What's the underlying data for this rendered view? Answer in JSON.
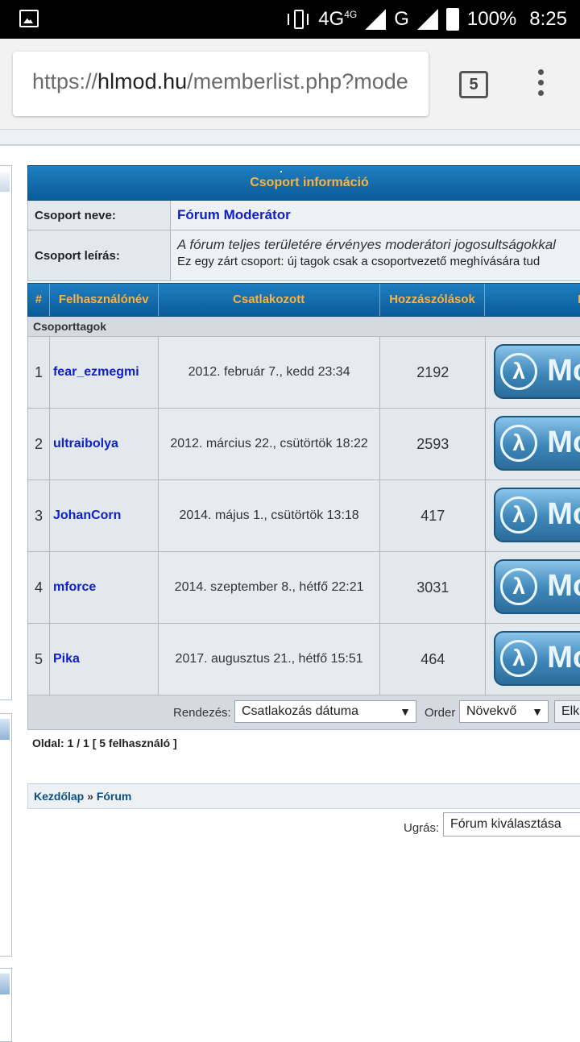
{
  "status_bar": {
    "network": "4G",
    "network_sup": "4G",
    "network2": "G",
    "battery": "100%",
    "time": "8:25"
  },
  "browser": {
    "url_prefix": "https://",
    "url_host": "hlmod.hu",
    "url_path": "/memberlist.php?mode",
    "tab_count": "5"
  },
  "group": {
    "header": "Csoport információ",
    "name_label": "Csoport neve:",
    "name_value": "Fórum Moderátor",
    "desc_label": "Csoport leírás:",
    "desc_line1": "A fórum teljes területére érvényes moderátori jogosultságokkal",
    "desc_line2": "Ez egy zárt csoport: új tagok csak a csoportvezető meghívására tud"
  },
  "columns": {
    "num": "#",
    "user": "Felhasználónév",
    "joined": "Csatlakozott",
    "posts": "Hozzászólások",
    "rank": "R"
  },
  "section_label": "Csoporttagok",
  "members": [
    {
      "num": "1",
      "name": "fear_ezmegmi",
      "joined": "2012. február 7., kedd 23:34",
      "posts": "2192",
      "rank_text": "Mo"
    },
    {
      "num": "2",
      "name": "ultraibolya",
      "joined": "2012. március 22., csütörtök 18:22",
      "posts": "2593",
      "rank_text": "Mo"
    },
    {
      "num": "3",
      "name": "JohanCorn",
      "joined": "2014. május 1., csütörtök 13:18",
      "posts": "417",
      "rank_text": "Mo"
    },
    {
      "num": "4",
      "name": "mforce",
      "joined": "2014. szeptember 8., hétfő 22:21",
      "posts": "3031",
      "rank_text": "Mo"
    },
    {
      "num": "5",
      "name": "Pika",
      "joined": "2017. augusztus 21., hétfő 15:51",
      "posts": "464",
      "rank_text": "Mo"
    }
  ],
  "sort": {
    "label": "Rendezés:",
    "value": "Csatlakozás dátuma",
    "order_label": "Order",
    "order_value": "Növekvő",
    "go_button": "Elk"
  },
  "pagination": "Oldal: 1 / 1 [ 5 felhasználó ]",
  "breadcrumb": {
    "home": "Kezdőlap",
    "sep": " » ",
    "forum": "Fórum"
  },
  "jump": {
    "label": "Ugrás:",
    "value": "Fórum kiválasztása"
  }
}
